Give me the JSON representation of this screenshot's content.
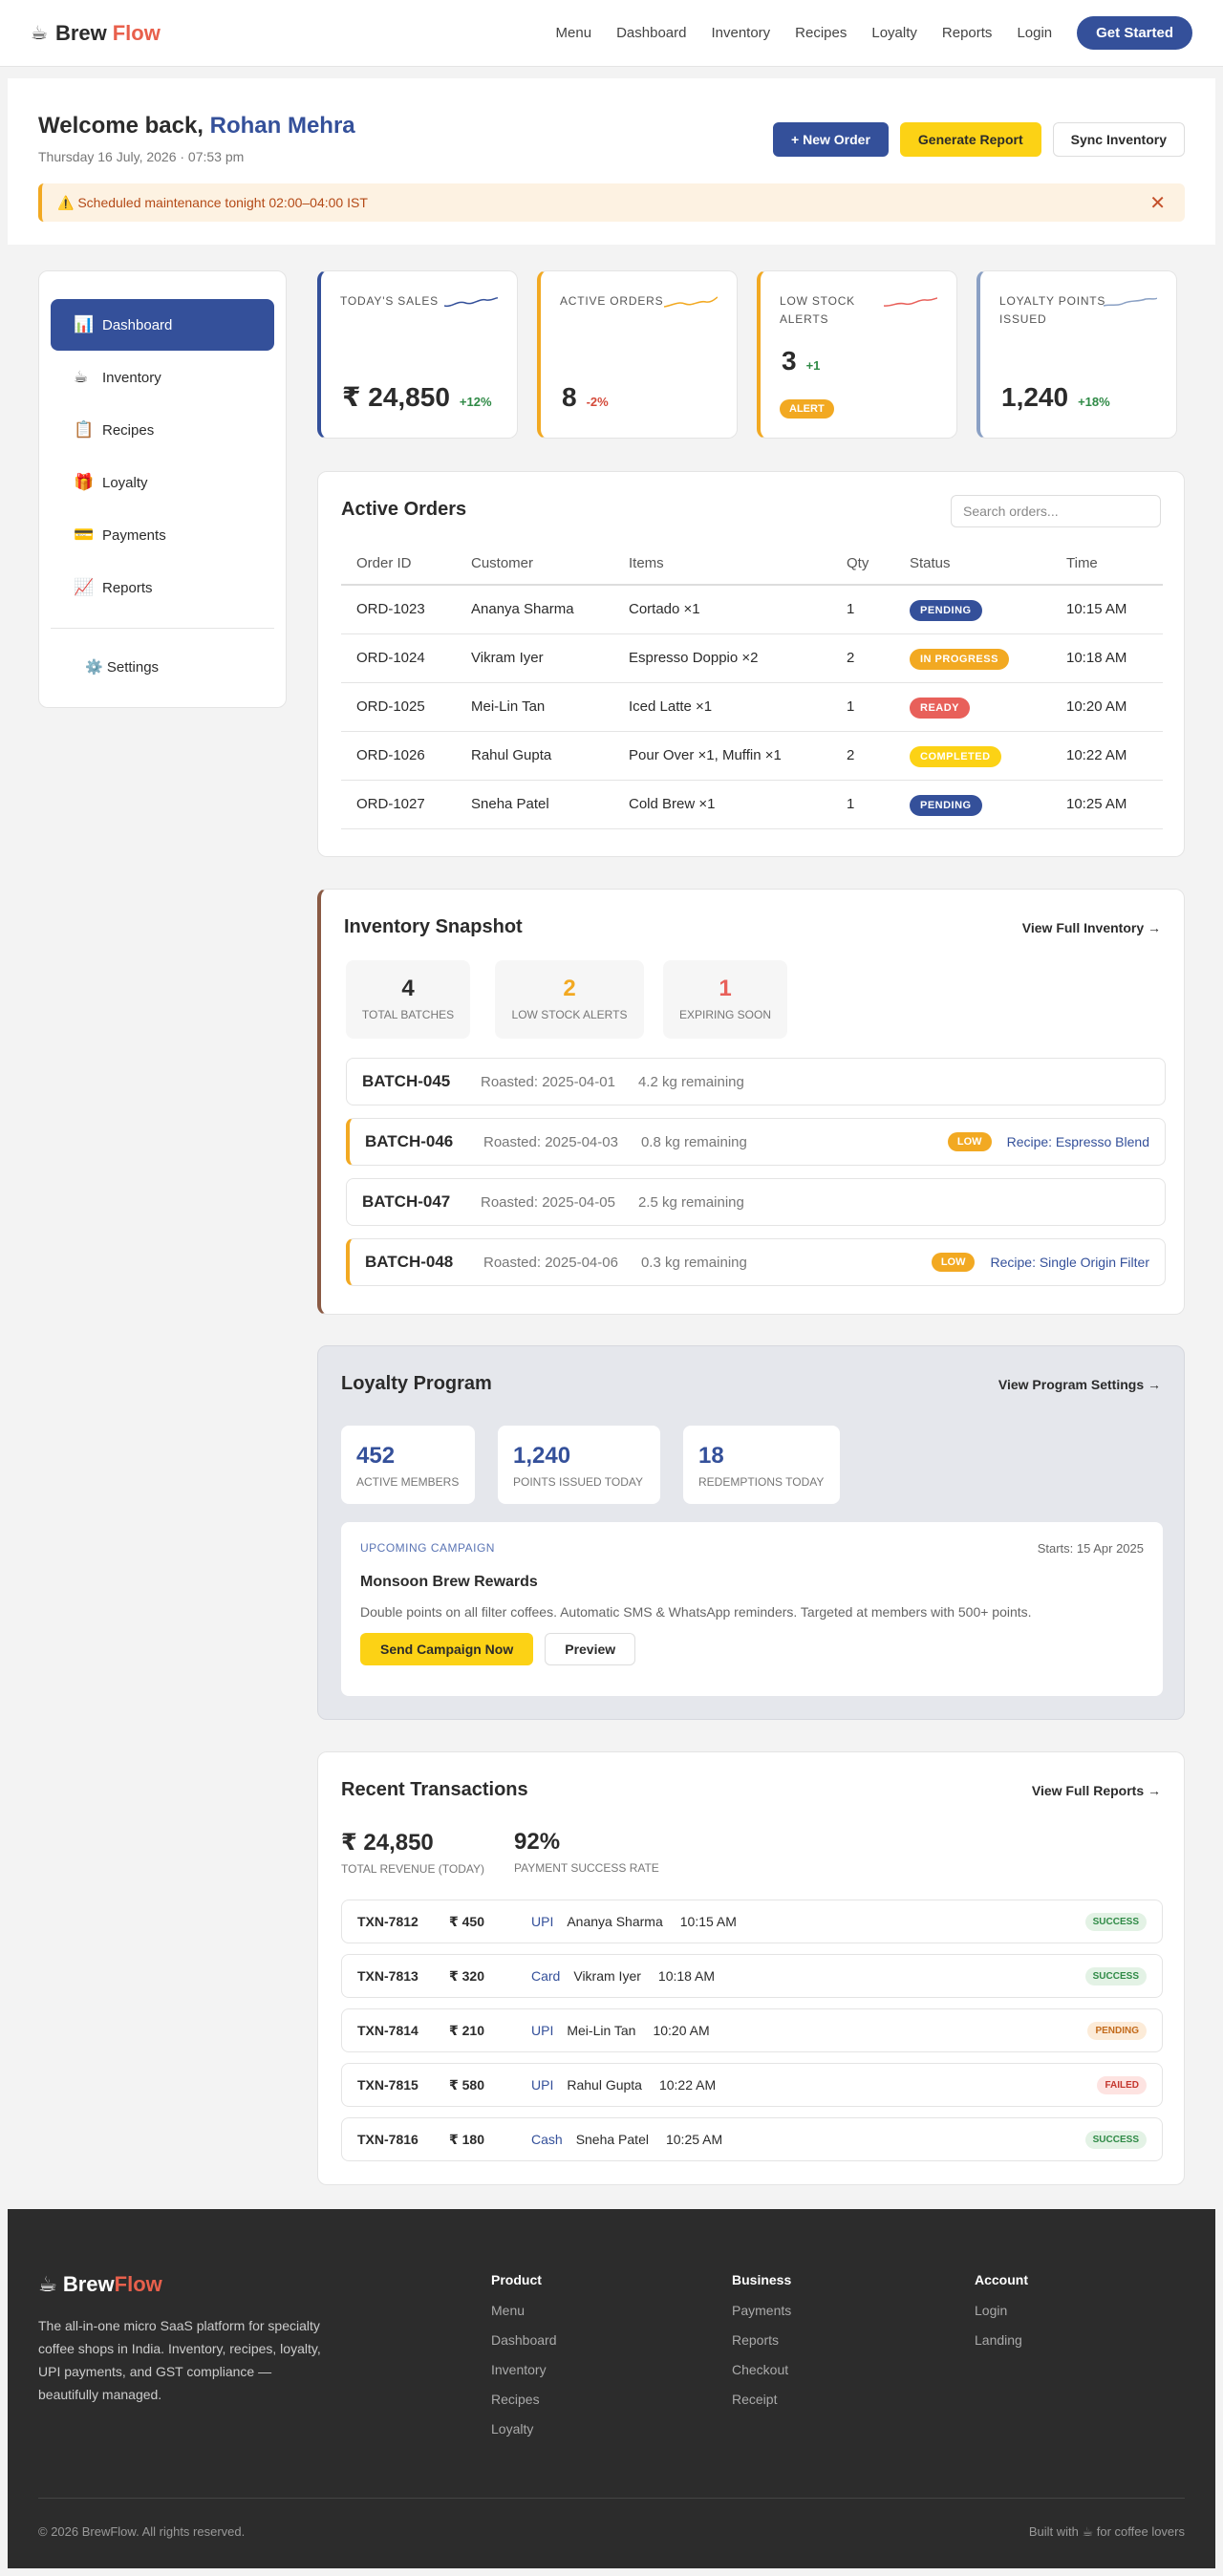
{
  "nav": {
    "logo_icon": "coffee-cup-icon",
    "brand_a": "Brew",
    "brand_b": "Flow",
    "links": [
      "Menu",
      "Dashboard",
      "Inventory",
      "Recipes",
      "Loyalty",
      "Reports",
      "Login"
    ],
    "cta": "Get Started"
  },
  "welcome": {
    "greeting": "Welcome back,",
    "name": "Rohan Mehra",
    "date": "Thursday 16 July, 2026 · 07:53 pm",
    "btn_new": "+ New Order",
    "btn_report": "Generate Report",
    "btn_sync": "Sync Inventory",
    "alert": "⚠️ Scheduled maintenance tonight 02:00–04:00 IST",
    "alert_close": "✕"
  },
  "sidebar": {
    "items": [
      {
        "icon": "📊",
        "label": "Dashboard"
      },
      {
        "icon": "☕",
        "label": "Inventory"
      },
      {
        "icon": "📋",
        "label": "Recipes"
      },
      {
        "icon": "🎁",
        "label": "Loyalty"
      },
      {
        "icon": "💳",
        "label": "Payments"
      },
      {
        "icon": "📈",
        "label": "Reports"
      }
    ],
    "settings": "⚙️ Settings"
  },
  "stats": [
    {
      "label": "Today's Sales",
      "value": "₹ 24,850",
      "change": "+12%",
      "color": "#34509a"
    },
    {
      "label": "Active Orders",
      "value": "8",
      "change": "-2%",
      "color": "#f2a922"
    },
    {
      "label": "Low Stock Alerts",
      "value": "3",
      "change": "+1",
      "badge": "ALERT",
      "color": "#f2a922"
    },
    {
      "label": "Loyalty Points Issued",
      "value": "1,240",
      "change": "+18%",
      "color": "#8aa0c4"
    }
  ],
  "orders": {
    "title": "Active Orders",
    "search_placeholder": "Search orders...",
    "columns": [
      "Order ID",
      "Customer",
      "Items",
      "Qty",
      "Status",
      "Time"
    ],
    "rows": [
      {
        "id": "ORD-1023",
        "customer": "Ananya Sharma",
        "items": "Cortado ×1",
        "qty": "1",
        "status": "PENDING",
        "time": "10:15 AM"
      },
      {
        "id": "ORD-1024",
        "customer": "Vikram Iyer",
        "items": "Espresso Doppio ×2",
        "qty": "2",
        "status": "IN PROGRESS",
        "time": "10:18 AM"
      },
      {
        "id": "ORD-1025",
        "customer": "Mei-Lin Tan",
        "items": "Iced Latte ×1",
        "qty": "1",
        "status": "READY",
        "time": "10:20 AM"
      },
      {
        "id": "ORD-1026",
        "customer": "Rahul Gupta",
        "items": "Pour Over ×1, Muffin ×1",
        "qty": "2",
        "status": "COMPLETED",
        "time": "10:22 AM"
      },
      {
        "id": "ORD-1027",
        "customer": "Sneha Patel",
        "items": "Cold Brew ×1",
        "qty": "1",
        "status": "PENDING",
        "time": "10:25 AM"
      }
    ]
  },
  "inventory": {
    "title": "Inventory Snapshot",
    "link": "View Full Inventory →",
    "summary": [
      {
        "value": "4",
        "label": "TOTAL BATCHES",
        "color": "#2b2b2b"
      },
      {
        "value": "2",
        "label": "LOW STOCK ALERTS",
        "color": "#f2a922"
      },
      {
        "value": "1",
        "label": "EXPIRING SOON",
        "color": "#e8605a"
      }
    ],
    "batches": [
      {
        "id": "BATCH-045",
        "roasted": "Roasted: 2025-04-01",
        "remaining": "4.2 kg remaining",
        "low": "",
        "recipe": ""
      },
      {
        "id": "BATCH-046",
        "roasted": "Roasted: 2025-04-03",
        "remaining": "0.8 kg remaining",
        "low": "LOW",
        "recipe": "Recipe: Espresso Blend"
      },
      {
        "id": "BATCH-047",
        "roasted": "Roasted: 2025-04-05",
        "remaining": "2.5 kg remaining",
        "low": "",
        "recipe": ""
      },
      {
        "id": "BATCH-048",
        "roasted": "Roasted: 2025-04-06",
        "remaining": "0.3 kg remaining",
        "low": "LOW",
        "recipe": "Recipe: Single Origin Filter"
      }
    ]
  },
  "loyalty": {
    "title": "Loyalty Program",
    "link": "View Program Settings →",
    "stats": [
      {
        "value": "452",
        "label": "ACTIVE MEMBERS"
      },
      {
        "value": "1,240",
        "label": "POINTS ISSUED TODAY"
      },
      {
        "value": "18",
        "label": "REDEMPTIONS TODAY"
      }
    ],
    "campaign": {
      "tag": "UPCOMING CAMPAIGN",
      "starts": "Starts: 15 Apr 2025",
      "name": "Monsoon Brew Rewards",
      "desc": "Double points on all filter coffees. Automatic SMS & WhatsApp reminders. Targeted at members with 500+ points.",
      "send": "Send Campaign Now",
      "preview": "Preview"
    }
  },
  "transactions": {
    "title": "Recent Transactions",
    "link": "View Full Reports →",
    "revenue": "₹ 24,850",
    "revenue_label": "TOTAL REVENUE (TODAY)",
    "rate": "92%",
    "rate_label": "PAYMENT SUCCESS RATE",
    "rows": [
      {
        "id": "TXN-7812",
        "amount": "₹ 450",
        "method": "UPI",
        "customer": "Ananya Sharma",
        "time": "10:15 AM",
        "status": "SUCCESS"
      },
      {
        "id": "TXN-7813",
        "amount": "₹ 320",
        "method": "Card",
        "customer": "Vikram Iyer",
        "time": "10:18 AM",
        "status": "SUCCESS"
      },
      {
        "id": "TXN-7814",
        "amount": "₹ 210",
        "method": "UPI",
        "customer": "Mei-Lin Tan",
        "time": "10:20 AM",
        "status": "PENDING"
      },
      {
        "id": "TXN-7815",
        "amount": "₹ 580",
        "method": "UPI",
        "customer": "Rahul Gupta",
        "time": "10:22 AM",
        "status": "FAILED"
      },
      {
        "id": "TXN-7816",
        "amount": "₹ 180",
        "method": "Cash",
        "customer": "Sneha Patel",
        "time": "10:25 AM",
        "status": "SUCCESS"
      }
    ]
  },
  "footer": {
    "brand_a": "Brew",
    "brand_b": "Flow",
    "desc": "The all-in-one micro SaaS platform for specialty coffee shops in India. Inventory, recipes, loyalty, UPI payments, and GST compliance — beautifully managed.",
    "cols": [
      {
        "title": "Product",
        "links": [
          "Menu",
          "Dashboard",
          "Inventory",
          "Recipes",
          "Loyalty"
        ]
      },
      {
        "title": "Business",
        "links": [
          "Payments",
          "Reports",
          "Checkout",
          "Receipt"
        ]
      },
      {
        "title": "Account",
        "links": [
          "Login",
          "Landing"
        ]
      }
    ],
    "copyright": "© 2026 BrewFlow. All rights reserved.",
    "built": "Built with ☕ for coffee lovers"
  }
}
